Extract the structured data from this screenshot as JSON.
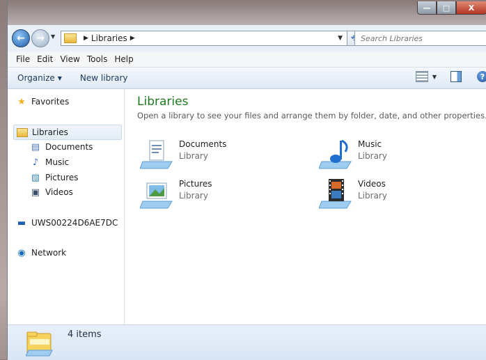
{
  "window": {
    "minimize": "—",
    "maximize": "□",
    "close": "X"
  },
  "address": {
    "crumbs": [
      "Libraries"
    ],
    "search_placeholder": "Search Libraries"
  },
  "menu": [
    "File",
    "Edit",
    "View",
    "Tools",
    "Help"
  ],
  "toolbar": {
    "organize": "Organize",
    "new_library": "New library"
  },
  "nav": {
    "favorites": "Favorites",
    "libraries": "Libraries",
    "library_items": [
      "Documents",
      "Music",
      "Pictures",
      "Videos"
    ],
    "computer": "UWS00224D6AE7DC",
    "network": "Network"
  },
  "content": {
    "title": "Libraries",
    "subtitle": "Open a library to see your files and arrange them by folder, date, and other properties.",
    "tiles": [
      {
        "name": "Documents",
        "type": "Library",
        "icon": "documents-library-icon"
      },
      {
        "name": "Music",
        "type": "Library",
        "icon": "music-library-icon"
      },
      {
        "name": "Pictures",
        "type": "Library",
        "icon": "pictures-library-icon"
      },
      {
        "name": "Videos",
        "type": "Library",
        "icon": "videos-library-icon"
      }
    ]
  },
  "status": {
    "text": "4 items"
  },
  "colors": {
    "title_green": "#1e7a1e",
    "toolbar_text": "#1e395b"
  }
}
